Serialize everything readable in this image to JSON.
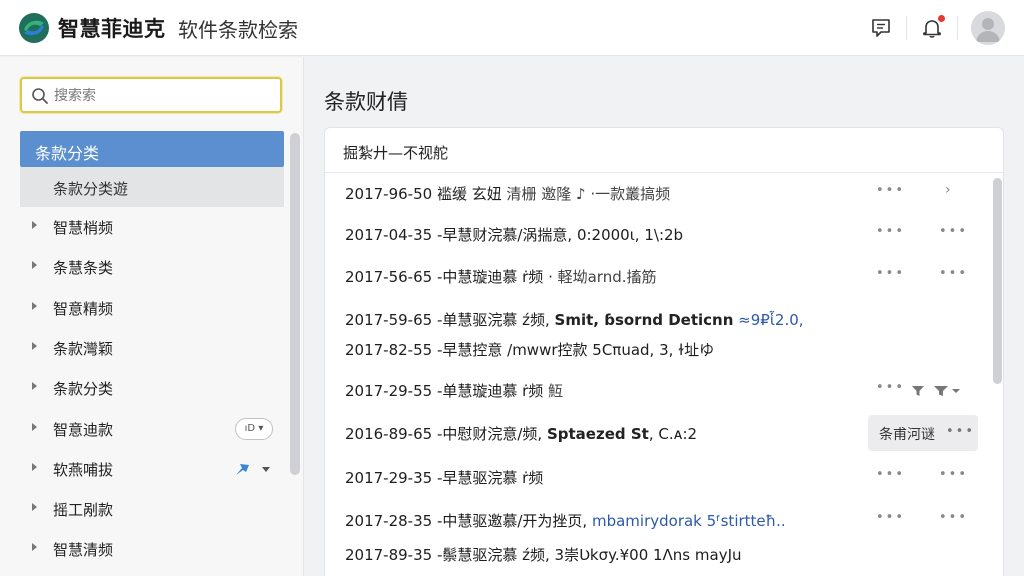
{
  "header": {
    "app_title": "智慧菲迪克",
    "app_subtitle": "软件条款检索",
    "icons": [
      "logo-icon",
      "feedback-icon",
      "bell-icon",
      "user-avatar-icon"
    ]
  },
  "sidebar": {
    "search_placeholder": "搜索索",
    "category_header": "条款分类",
    "category_sub": "条款分类遊",
    "items": [
      {
        "label": "智慧梢频"
      },
      {
        "label": "条慧条类"
      },
      {
        "label": "智意精频"
      },
      {
        "label": "条款灣颖"
      },
      {
        "label": "条款分类"
      },
      {
        "label": "智意迪款",
        "control": "ıD ▾"
      },
      {
        "label": "软燕哺拔"
      },
      {
        "label": "摇工剐款"
      },
      {
        "label": "智慧清频"
      }
    ]
  },
  "main": {
    "page_title": "条款财倩",
    "card_title": "掘紮廾—不视舵",
    "rows": [
      {
        "date": "2017-96-50",
        "p1": " 褴缓 玄妞 ",
        "p2": " 清栅 邀隆 ♪ ·一款叢搞频",
        "action": "chevron"
      },
      {
        "date": "2017-04-35",
        "p1": " -早慧财浣慕/涡揣意, 0:2000ι, 1\\:2b",
        "p2": "",
        "action": "dots2"
      },
      {
        "date": "2017-56-65",
        "p1": " -中慧璇迪慕 ṙ频 ·",
        "p2": " 軽坳arnd.搐筋",
        "action": "dots2"
      },
      {
        "date": "2017-59-65",
        "p1": " -单慧驱浣慕 ź频, ",
        "strong": "Smit, ɓsornd Deticnn",
        "link": " ≈9₽ἷ2.0,",
        "action": "none"
      },
      {
        "date": "2017-82-55",
        "p1": " -早慧控意 /mwwr控款 5Cπuad, 3, ɫ址ゆ",
        "p2": "",
        "action": "none"
      },
      {
        "date": "2017-29-55",
        "p1": " -单慧璇迪慕 ṙ频 ",
        "p2": " 魱",
        "action": "filters"
      },
      {
        "date": "2016-89-65",
        "p1": " -中慰财浣意/频, ",
        "strong": "Sptaezed St",
        "p2": ", C.ᴀ:2",
        "action": "tag",
        "tag": "条甫河谜"
      },
      {
        "date": "2017-29-35",
        "p1": " -早慧驱浣慕 ṙ频",
        "p2": "",
        "action": "dots2"
      },
      {
        "date": "2017-28-35",
        "p1": " -中慧驱邀慕/开为挫页, ",
        "link": "mbamirydorak 5ᶠstirtteħ..",
        "action": "dots2"
      },
      {
        "date": "2017-89-35",
        "p1": " -鬃慧驱浣慕 ź频, ",
        "p2": " 3崇Ʋkσy.¥00 1Ʌns mayJu",
        "action": "none"
      }
    ]
  },
  "colors": {
    "accent": "#5b8fd0",
    "search_border": "#d9c94a",
    "notification_dot": "#e53935",
    "link": "#2d5aa8"
  }
}
